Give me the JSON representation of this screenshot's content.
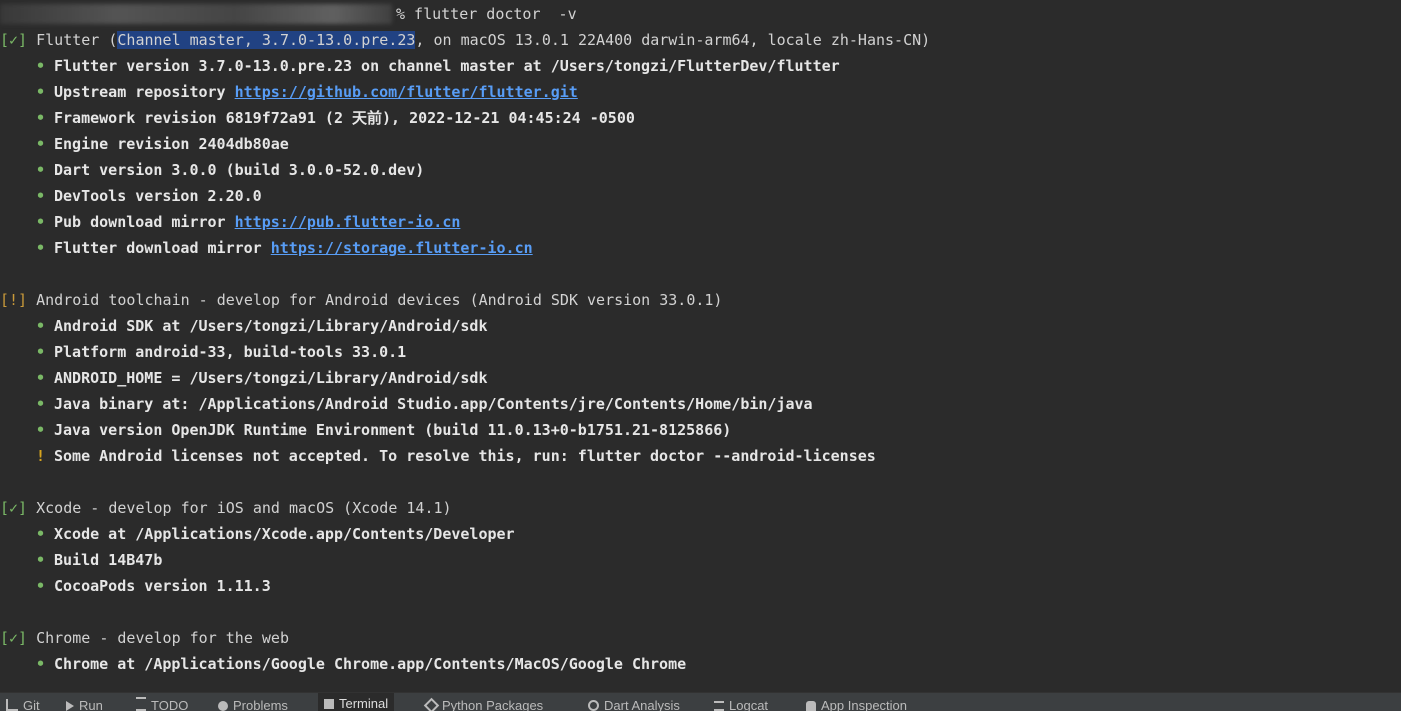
{
  "prompt": {
    "command": "% flutter doctor  -v"
  },
  "sections": {
    "flutter": {
      "status": "[✓]",
      "name": "Flutter (",
      "highlight": "Channel master, 3.7.0-13.0.pre.23",
      "rest": ", on macOS 13.0.1 22A400 darwin-arm64, locale zh-Hans-CN)",
      "items": {
        "i0": "Flutter version 3.7.0-13.0.pre.23 on channel master at /Users/tongzi/FlutterDev/flutter",
        "i1_label": "Upstream repository ",
        "i1_link": "https://github.com/flutter/flutter.git",
        "i2": "Framework revision 6819f72a91 (2 天前), 2022-12-21 04:45:24 -0500",
        "i3": "Engine revision 2404db80ae",
        "i4": "Dart version 3.0.0 (build 3.0.0-52.0.dev)",
        "i5": "DevTools version 2.20.0",
        "i6_label": "Pub download mirror ",
        "i6_link": "https://pub.flutter-io.cn",
        "i7_label": "Flutter download mirror ",
        "i7_link": "https://storage.flutter-io.cn"
      }
    },
    "android": {
      "status": "[!]",
      "header": "Android toolchain - develop for Android devices (Android SDK version 33.0.1)",
      "items": {
        "i0": "Android SDK at /Users/tongzi/Library/Android/sdk",
        "i1": "Platform android-33, build-tools 33.0.1",
        "i2": "ANDROID_HOME = /Users/tongzi/Library/Android/sdk",
        "i3": "Java binary at: /Applications/Android Studio.app/Contents/jre/Contents/Home/bin/java",
        "i4": "Java version OpenJDK Runtime Environment (build 11.0.13+0-b1751.21-8125866)",
        "i5": "Some Android licenses not accepted. To resolve this, run: flutter doctor --android-licenses"
      }
    },
    "xcode": {
      "status": "[✓]",
      "header": "Xcode - develop for iOS and macOS (Xcode 14.1)",
      "items": {
        "i0": "Xcode at /Applications/Xcode.app/Contents/Developer",
        "i1": "Build 14B47b",
        "i2": "CocoaPods version 1.11.3"
      }
    },
    "chrome": {
      "status": "[✓]",
      "header": "Chrome - develop for the web",
      "items": {
        "i0": "Chrome at /Applications/Google Chrome.app/Contents/MacOS/Google Chrome"
      }
    }
  },
  "glyphs": {
    "bullet": "•",
    "bang": "!"
  },
  "toolbar": {
    "tabs": [
      "Git",
      "Run",
      "TODO",
      "Problems",
      "Terminal",
      "Python Packages",
      "Dart Analysis",
      "Logcat",
      "App Inspection"
    ],
    "active": "Terminal"
  },
  "colors": {
    "background": "#2b2b2b",
    "ok": "#7ab866",
    "warn": "#d6a41e",
    "link": "#589df6",
    "selection": "#214283"
  }
}
